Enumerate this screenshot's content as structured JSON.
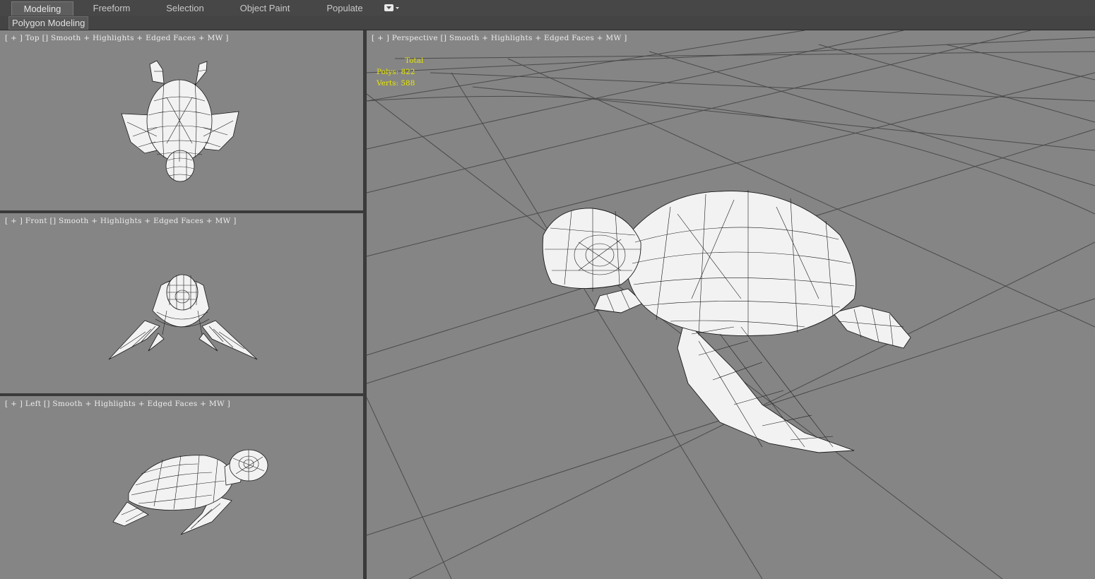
{
  "ribbon": {
    "tabs": [
      {
        "label": "Modeling",
        "active": true
      },
      {
        "label": "Freeform",
        "active": false
      },
      {
        "label": "Selection",
        "active": false
      },
      {
        "label": "Object Paint",
        "active": false
      },
      {
        "label": "Populate",
        "active": false
      }
    ],
    "dropdown_icon": "ribbon-options-icon",
    "panel_label": "Polygon Modeling"
  },
  "viewports": {
    "top": {
      "label": "[ + ] Top [] Smooth + Highlights + Edged Faces + MW ]"
    },
    "front": {
      "label": "[ + ] Front [] Smooth + Highlights + Edged Faces + MW ]"
    },
    "left": {
      "label": "[ + ] Left [] Smooth + Highlights + Edged Faces + MW ]"
    },
    "perspective": {
      "label": "[ + ] Perspective [] Smooth + Highlights + Edged Faces + MW ]",
      "stats": {
        "header": "Total",
        "polys": "Polys: 822",
        "verts": "Verts: 588"
      }
    }
  },
  "colors": {
    "viewport_bg": "#858585",
    "stats_text": "#e6e600",
    "model_fill": "#f2f2f2",
    "wire": "#1a1a1a"
  }
}
